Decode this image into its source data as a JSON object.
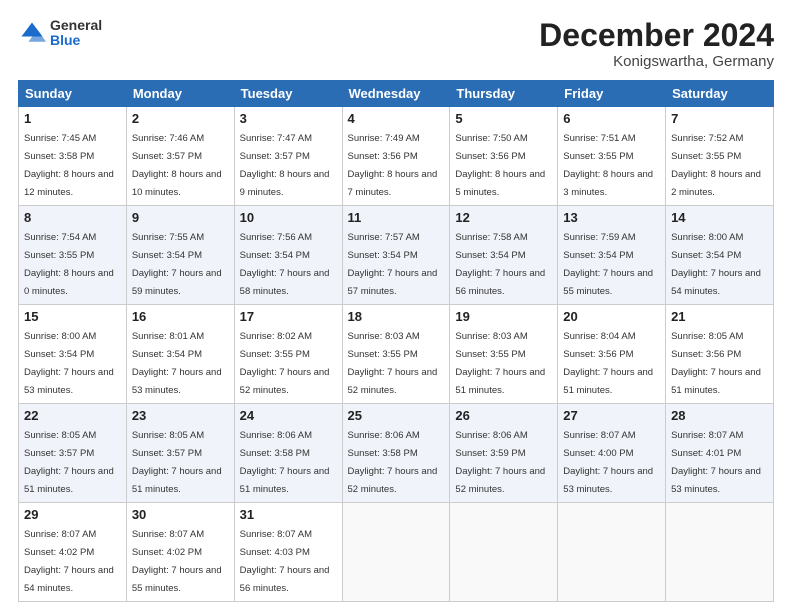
{
  "header": {
    "logo_general": "General",
    "logo_blue": "Blue",
    "month_title": "December 2024",
    "location": "Konigswartha, Germany"
  },
  "days_of_week": [
    "Sunday",
    "Monday",
    "Tuesday",
    "Wednesday",
    "Thursday",
    "Friday",
    "Saturday"
  ],
  "weeks": [
    [
      {
        "day": "1",
        "sunrise": "7:45 AM",
        "sunset": "3:58 PM",
        "daylight": "8 hours and 12 minutes."
      },
      {
        "day": "2",
        "sunrise": "7:46 AM",
        "sunset": "3:57 PM",
        "daylight": "8 hours and 10 minutes."
      },
      {
        "day": "3",
        "sunrise": "7:47 AM",
        "sunset": "3:57 PM",
        "daylight": "8 hours and 9 minutes."
      },
      {
        "day": "4",
        "sunrise": "7:49 AM",
        "sunset": "3:56 PM",
        "daylight": "8 hours and 7 minutes."
      },
      {
        "day": "5",
        "sunrise": "7:50 AM",
        "sunset": "3:56 PM",
        "daylight": "8 hours and 5 minutes."
      },
      {
        "day": "6",
        "sunrise": "7:51 AM",
        "sunset": "3:55 PM",
        "daylight": "8 hours and 3 minutes."
      },
      {
        "day": "7",
        "sunrise": "7:52 AM",
        "sunset": "3:55 PM",
        "daylight": "8 hours and 2 minutes."
      }
    ],
    [
      {
        "day": "8",
        "sunrise": "7:54 AM",
        "sunset": "3:55 PM",
        "daylight": "8 hours and 0 minutes."
      },
      {
        "day": "9",
        "sunrise": "7:55 AM",
        "sunset": "3:54 PM",
        "daylight": "7 hours and 59 minutes."
      },
      {
        "day": "10",
        "sunrise": "7:56 AM",
        "sunset": "3:54 PM",
        "daylight": "7 hours and 58 minutes."
      },
      {
        "day": "11",
        "sunrise": "7:57 AM",
        "sunset": "3:54 PM",
        "daylight": "7 hours and 57 minutes."
      },
      {
        "day": "12",
        "sunrise": "7:58 AM",
        "sunset": "3:54 PM",
        "daylight": "7 hours and 56 minutes."
      },
      {
        "day": "13",
        "sunrise": "7:59 AM",
        "sunset": "3:54 PM",
        "daylight": "7 hours and 55 minutes."
      },
      {
        "day": "14",
        "sunrise": "8:00 AM",
        "sunset": "3:54 PM",
        "daylight": "7 hours and 54 minutes."
      }
    ],
    [
      {
        "day": "15",
        "sunrise": "8:00 AM",
        "sunset": "3:54 PM",
        "daylight": "7 hours and 53 minutes."
      },
      {
        "day": "16",
        "sunrise": "8:01 AM",
        "sunset": "3:54 PM",
        "daylight": "7 hours and 53 minutes."
      },
      {
        "day": "17",
        "sunrise": "8:02 AM",
        "sunset": "3:55 PM",
        "daylight": "7 hours and 52 minutes."
      },
      {
        "day": "18",
        "sunrise": "8:03 AM",
        "sunset": "3:55 PM",
        "daylight": "7 hours and 52 minutes."
      },
      {
        "day": "19",
        "sunrise": "8:03 AM",
        "sunset": "3:55 PM",
        "daylight": "7 hours and 51 minutes."
      },
      {
        "day": "20",
        "sunrise": "8:04 AM",
        "sunset": "3:56 PM",
        "daylight": "7 hours and 51 minutes."
      },
      {
        "day": "21",
        "sunrise": "8:05 AM",
        "sunset": "3:56 PM",
        "daylight": "7 hours and 51 minutes."
      }
    ],
    [
      {
        "day": "22",
        "sunrise": "8:05 AM",
        "sunset": "3:57 PM",
        "daylight": "7 hours and 51 minutes."
      },
      {
        "day": "23",
        "sunrise": "8:05 AM",
        "sunset": "3:57 PM",
        "daylight": "7 hours and 51 minutes."
      },
      {
        "day": "24",
        "sunrise": "8:06 AM",
        "sunset": "3:58 PM",
        "daylight": "7 hours and 51 minutes."
      },
      {
        "day": "25",
        "sunrise": "8:06 AM",
        "sunset": "3:58 PM",
        "daylight": "7 hours and 52 minutes."
      },
      {
        "day": "26",
        "sunrise": "8:06 AM",
        "sunset": "3:59 PM",
        "daylight": "7 hours and 52 minutes."
      },
      {
        "day": "27",
        "sunrise": "8:07 AM",
        "sunset": "4:00 PM",
        "daylight": "7 hours and 53 minutes."
      },
      {
        "day": "28",
        "sunrise": "8:07 AM",
        "sunset": "4:01 PM",
        "daylight": "7 hours and 53 minutes."
      }
    ],
    [
      {
        "day": "29",
        "sunrise": "8:07 AM",
        "sunset": "4:02 PM",
        "daylight": "7 hours and 54 minutes."
      },
      {
        "day": "30",
        "sunrise": "8:07 AM",
        "sunset": "4:02 PM",
        "daylight": "7 hours and 55 minutes."
      },
      {
        "day": "31",
        "sunrise": "8:07 AM",
        "sunset": "4:03 PM",
        "daylight": "7 hours and 56 minutes."
      },
      null,
      null,
      null,
      null
    ]
  ]
}
